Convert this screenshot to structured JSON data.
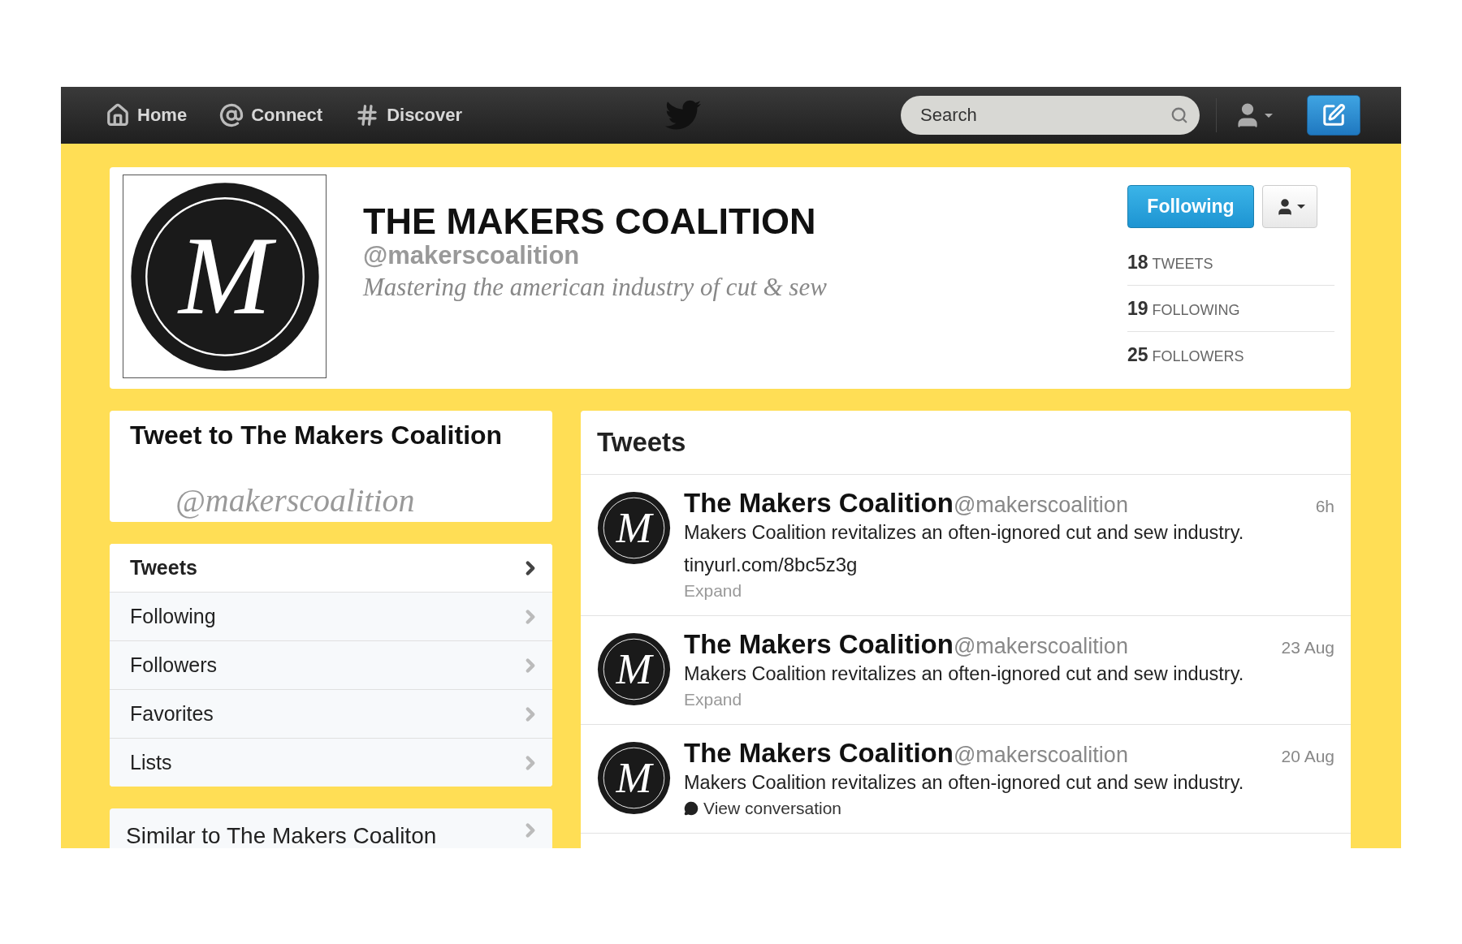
{
  "nav": {
    "items": [
      {
        "label": "Home"
      },
      {
        "label": "Connect"
      },
      {
        "label": "Discover"
      }
    ],
    "search": {
      "placeholder": "Search"
    }
  },
  "profile": {
    "monogram": "M",
    "name": "THE MAKERS COALITION",
    "handle": "@makerscoalition",
    "bio": "Mastering the american industry of cut & sew",
    "follow_button": "Following",
    "stats": [
      {
        "count": "18",
        "label": "TWEETS"
      },
      {
        "count": "19",
        "label": "FOLLOWING"
      },
      {
        "count": "25",
        "label": "FOLLOWERS"
      }
    ]
  },
  "tweet_to": {
    "title": "Tweet to The Makers Coalition",
    "handle": "@makerscoalition"
  },
  "profile_nav": [
    {
      "label": "Tweets",
      "selected": true
    },
    {
      "label": "Following",
      "selected": false
    },
    {
      "label": "Followers",
      "selected": false
    },
    {
      "label": "Favorites",
      "selected": false
    },
    {
      "label": "Lists",
      "selected": false
    }
  ],
  "similar": {
    "title": "Similar to The Makers Coaliton"
  },
  "timeline": {
    "title": "Tweets",
    "tweets": [
      {
        "monogram": "M",
        "name": "The Makers Coalition",
        "handle": "@makerscoalition",
        "time": "6h",
        "text": "Makers Coalition revitalizes an often-ignored cut and sew industry.",
        "link": "tinyurl.com/8bc5z3g",
        "action": {
          "kind": "expand",
          "label": "Expand"
        }
      },
      {
        "monogram": "M",
        "name": "The Makers Coalition",
        "handle": "@makerscoalition",
        "time": "23 Aug",
        "text": "Makers Coalition revitalizes an often-ignored cut and sew industry.",
        "action": {
          "kind": "expand",
          "label": "Expand"
        }
      },
      {
        "monogram": "M",
        "name": "The Makers Coalition",
        "handle": "@makerscoalition",
        "time": "20 Aug",
        "text": "Makers Coalition revitalizes an often-ignored cut and sew industry.",
        "action": {
          "kind": "conversation",
          "label": "View conversation"
        }
      }
    ]
  }
}
